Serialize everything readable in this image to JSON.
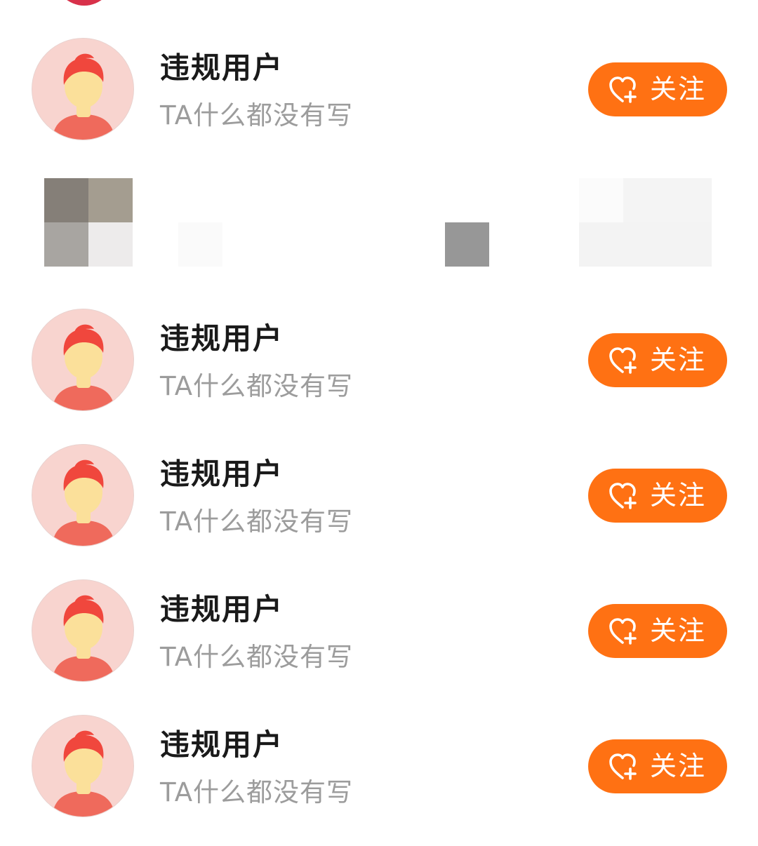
{
  "users": [
    {
      "name": "违规用户",
      "bio": "TA什么都没有写",
      "follow_label": "关注"
    },
    {
      "name": "违规用户",
      "bio": "TA什么都没有写",
      "follow_label": "关注"
    },
    {
      "name": "违规用户",
      "bio": "TA什么都没有写",
      "follow_label": "关注"
    },
    {
      "name": "违规用户",
      "bio": "TA什么都没有写",
      "follow_label": "关注"
    },
    {
      "name": "违规用户",
      "bio": "TA什么都没有写",
      "follow_label": "关注"
    }
  ],
  "icons": {
    "follow": "heart-plus-icon",
    "avatar": "default-avatar-icon"
  },
  "colors": {
    "accent": "#ff7113",
    "name_text": "#1a1a1a",
    "bio_text": "#9c9c9c",
    "avatar_bg": "#f8d4cf"
  }
}
